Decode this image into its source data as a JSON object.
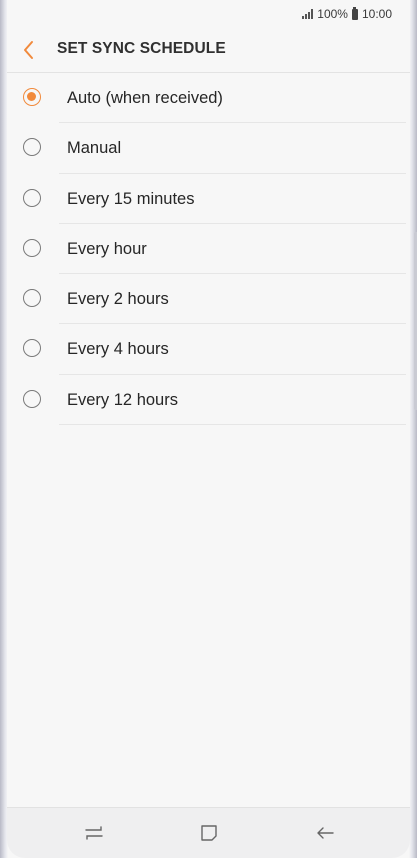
{
  "status": {
    "battery_percent": "100%",
    "time": "10:00"
  },
  "header": {
    "title": "SET SYNC SCHEDULE",
    "back_icon": "chevron-left-icon"
  },
  "accent_color": "#f18a3c",
  "options": [
    {
      "label": "Auto (when received)",
      "selected": true
    },
    {
      "label": "Manual",
      "selected": false
    },
    {
      "label": "Every 15 minutes",
      "selected": false
    },
    {
      "label": "Every hour",
      "selected": false
    },
    {
      "label": "Every 2 hours",
      "selected": false
    },
    {
      "label": "Every 4 hours",
      "selected": false
    },
    {
      "label": "Every 12 hours",
      "selected": false
    }
  ],
  "navbar": {
    "recents_icon": "recent-apps-icon",
    "home_icon": "home-icon",
    "back_icon": "back-arrow-icon"
  }
}
